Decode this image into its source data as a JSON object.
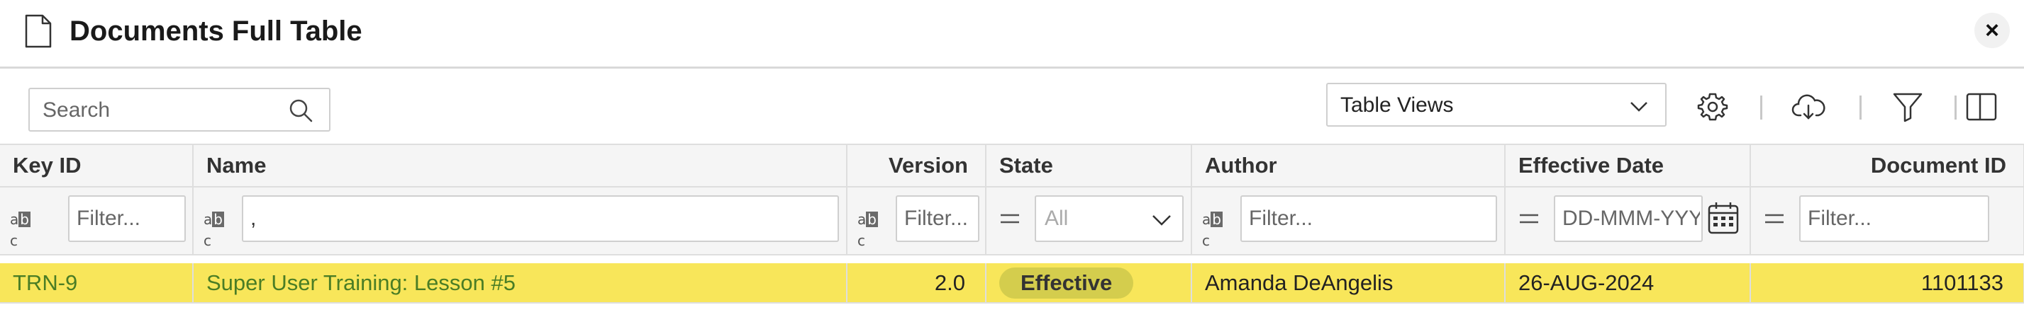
{
  "header": {
    "title": "Documents Full Table"
  },
  "toolbar": {
    "search_placeholder": "Search",
    "table_views_label": "Table Views"
  },
  "columns": [
    "Key ID",
    "Name",
    "Version",
    "State",
    "Author",
    "Effective Date",
    "Document ID"
  ],
  "filters": {
    "key_id_placeholder": "Filter...",
    "name_value": ",",
    "version_placeholder": "Filter...",
    "state_value": "All",
    "author_placeholder": "Filter...",
    "date_placeholder": "DD-MMM-YYYY",
    "document_id_placeholder": "Filter..."
  },
  "rows": [
    {
      "key_id": "TRN-9",
      "name": "Super User Training: Lesson #5",
      "version": "2.0",
      "state": "Effective",
      "author": "Amanda DeAngelis",
      "effective_date": "26-AUG-2024",
      "document_id": "1101133"
    }
  ],
  "colors": {
    "highlight": "#f8e65a",
    "link": "#4a7d25",
    "badge": "#d4cd4d"
  }
}
